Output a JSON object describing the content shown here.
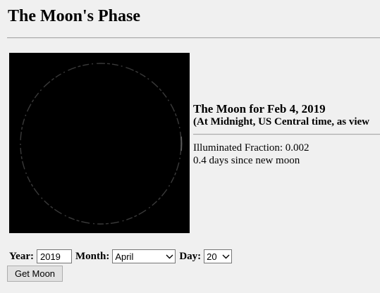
{
  "page": {
    "title": "The Moon's Phase"
  },
  "moon": {
    "image_alt": "Moon phase image",
    "illuminated_fraction": 0.002,
    "colors": {
      "background": "#000000",
      "limb": "#3a3a3a"
    }
  },
  "info": {
    "date_heading": "The Moon for Feb 4, 2019",
    "subheading": "(At Midnight, US Central time, as view",
    "illuminated_line": "Illuminated Fraction: 0.002",
    "age_line": "0.4 days since new moon"
  },
  "form": {
    "year_label": "Year:",
    "year_value": "2019",
    "month_label": "Month:",
    "month_value": "April",
    "day_label": "Day:",
    "day_value": "20",
    "submit_label": "Get Moon"
  }
}
